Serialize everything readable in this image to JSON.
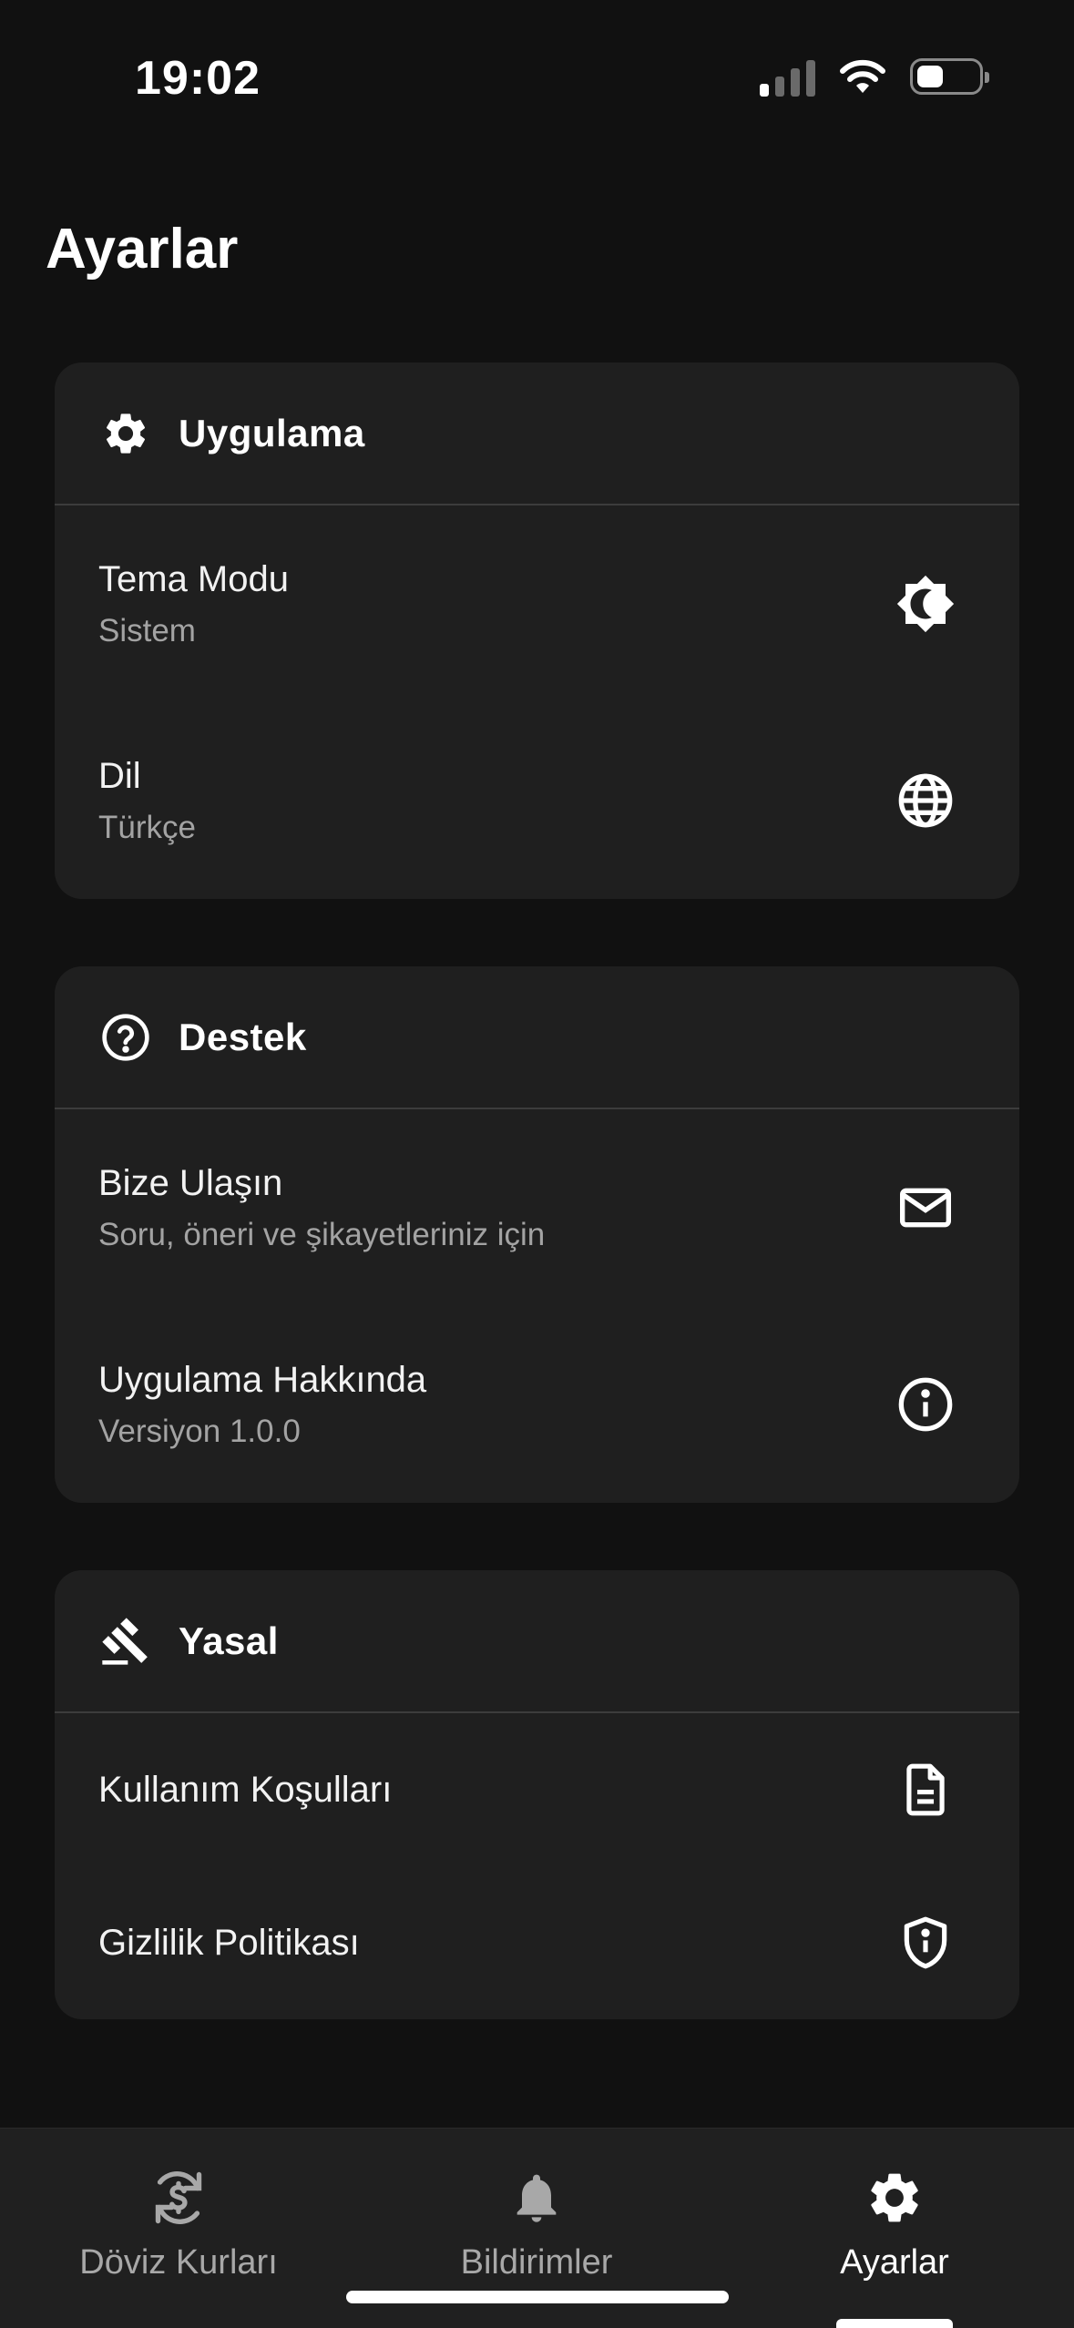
{
  "status_bar": {
    "time": "19:02"
  },
  "page": {
    "title": "Ayarlar"
  },
  "sections": [
    {
      "title": "Uygulama",
      "icon": "gear-icon",
      "items": [
        {
          "title": "Tema Modu",
          "subtitle": "Sistem",
          "icon": "brightness-icon"
        },
        {
          "title": "Dil",
          "subtitle": "Türkçe",
          "icon": "globe-icon"
        }
      ]
    },
    {
      "title": "Destek",
      "icon": "help-circle-icon",
      "items": [
        {
          "title": "Bize Ulaşın",
          "subtitle": "Soru, öneri ve şikayetleriniz için",
          "icon": "mail-icon"
        },
        {
          "title": "Uygulama Hakkında",
          "subtitle": "Versiyon 1.0.0",
          "icon": "info-icon"
        }
      ]
    },
    {
      "title": "Yasal",
      "icon": "gavel-icon",
      "items": [
        {
          "title": "Kullanım Koşulları",
          "icon": "document-icon"
        },
        {
          "title": "Gizlilik Politikası",
          "icon": "shield-icon"
        }
      ]
    }
  ],
  "tab_bar": {
    "tabs": [
      {
        "label": "Döviz Kurları",
        "icon": "currency-exchange-icon",
        "active": false
      },
      {
        "label": "Bildirimler",
        "icon": "bell-icon",
        "active": false
      },
      {
        "label": "Ayarlar",
        "icon": "gear-icon",
        "active": true
      }
    ]
  },
  "colors": {
    "background": "#111111",
    "card": "#1f1f1f",
    "divider": "#3c3c3c",
    "text_primary": "#f2f2f2",
    "text_secondary": "#a3a3a3",
    "tab_bar": "#202020"
  }
}
